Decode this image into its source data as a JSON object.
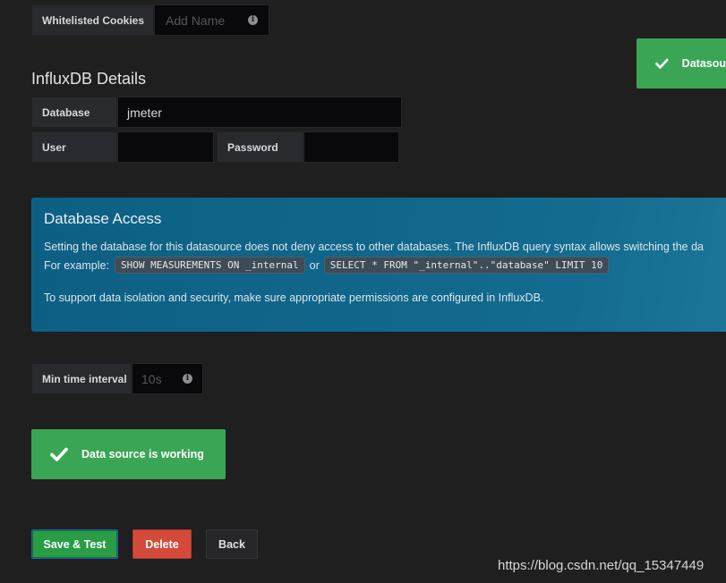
{
  "cookies": {
    "label": "Whitelisted Cookies",
    "placeholder": "Add Name",
    "info_icon": "info-icon"
  },
  "toast": {
    "text": "Datasou",
    "icon": "checkmark-icon",
    "color": "#3aa655"
  },
  "influx": {
    "title": "InfluxDB Details",
    "database_label": "Database",
    "database_value": "jmeter",
    "user_label": "User",
    "user_value": "",
    "password_label": "Password",
    "password_value": ""
  },
  "access": {
    "title": "Database Access",
    "line1": "Setting the database for this datasource does not deny access to other databases. The InfluxDB query syntax allows switching the da",
    "example_prefix": "For example:",
    "code1": "SHOW MEASUREMENTS ON _internal",
    "or_text": "or",
    "code2": "SELECT * FROM \"_internal\"..\"database\" LIMIT 10",
    "line3": "To support data isolation and security, make sure appropriate permissions are configured in InfluxDB.",
    "color": "#0d5f83"
  },
  "interval": {
    "label": "Min time interval",
    "placeholder": "10s",
    "info_icon": "info-icon"
  },
  "status": {
    "text": "Data source is working",
    "icon": "checkmark-icon",
    "color": "#3aa655"
  },
  "buttons": {
    "save_label": "Save & Test",
    "delete_label": "Delete",
    "back_label": "Back",
    "save_color": "#299c46",
    "delete_color": "#d44a3a"
  },
  "watermark": "https://blog.csdn.net/qq_15347449"
}
